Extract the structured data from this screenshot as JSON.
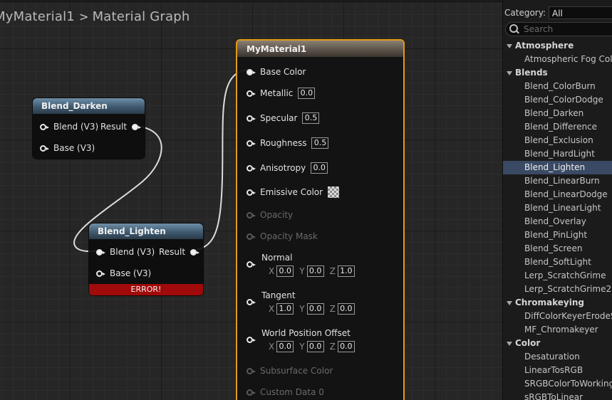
{
  "breadcrumb": {
    "asset": "MyMaterial1",
    "separator": ">",
    "graph": "Material Graph"
  },
  "nodes": {
    "blend_darken": {
      "title": "Blend_Darken",
      "pins": {
        "blend": "Blend (V3)",
        "base": "Base (V3)",
        "result": "Result"
      }
    },
    "blend_lighten": {
      "title": "Blend_Lighten",
      "pins": {
        "blend": "Blend (V3)",
        "base": "Base (V3)",
        "result": "Result"
      },
      "error": "ERROR!"
    }
  },
  "material": {
    "title": "MyMaterial1",
    "inputs": {
      "base_color": "Base Color",
      "metallic": {
        "label": "Metallic",
        "value": "0.0"
      },
      "specular": {
        "label": "Specular",
        "value": "0.5"
      },
      "roughness": {
        "label": "Roughness",
        "value": "0.5"
      },
      "anisotropy": {
        "label": "Anisotropy",
        "value": "0.0"
      },
      "emissive": "Emissive Color",
      "opacity": "Opacity",
      "opacity_mask": "Opacity Mask",
      "normal": {
        "label": "Normal",
        "x": "0.0",
        "y": "0.0",
        "z": "1.0"
      },
      "tangent": {
        "label": "Tangent",
        "x": "1.0",
        "y": "0.0",
        "z": "0.0"
      },
      "wpo": {
        "label": "World Position Offset",
        "x": "0.0",
        "y": "0.0",
        "z": "0.0"
      },
      "subsurface": "Subsurface Color",
      "custom_data": "Custom Data 0"
    },
    "axis_labels": {
      "x": "X",
      "y": "Y",
      "z": "Z"
    }
  },
  "palette": {
    "category_label": "Category:",
    "category_value": "All",
    "search_placeholder": "Search",
    "tree": [
      {
        "type": "category",
        "label": "Atmosphere"
      },
      {
        "type": "item",
        "label": "Atmospheric Fog Color"
      },
      {
        "type": "category",
        "label": "Blends"
      },
      {
        "type": "item",
        "label": "Blend_ColorBurn"
      },
      {
        "type": "item",
        "label": "Blend_ColorDodge"
      },
      {
        "type": "item",
        "label": "Blend_Darken"
      },
      {
        "type": "item",
        "label": "Blend_Difference"
      },
      {
        "type": "item",
        "label": "Blend_Exclusion"
      },
      {
        "type": "item",
        "label": "Blend_HardLight"
      },
      {
        "type": "item",
        "label": "Blend_Lighten",
        "selected": true
      },
      {
        "type": "item",
        "label": "Blend_LinearBurn"
      },
      {
        "type": "item",
        "label": "Blend_LinearDodge"
      },
      {
        "type": "item",
        "label": "Blend_LinearLight"
      },
      {
        "type": "item",
        "label": "Blend_Overlay"
      },
      {
        "type": "item",
        "label": "Blend_PinLight"
      },
      {
        "type": "item",
        "label": "Blend_Screen"
      },
      {
        "type": "item",
        "label": "Blend_SoftLight"
      },
      {
        "type": "item",
        "label": "Lerp_ScratchGrime"
      },
      {
        "type": "item",
        "label": "Lerp_ScratchGrime2"
      },
      {
        "type": "category",
        "label": "Chromakeying"
      },
      {
        "type": "item",
        "label": "DiffColorKeyerErodeSoft"
      },
      {
        "type": "item",
        "label": "MF_Chromakeyer"
      },
      {
        "type": "category",
        "label": "Color"
      },
      {
        "type": "item",
        "label": "Desaturation"
      },
      {
        "type": "item",
        "label": "LinearTosRGB"
      },
      {
        "type": "item",
        "label": "SRGBColorToWorkingColor"
      },
      {
        "type": "item",
        "label": "sRGBToLinear"
      }
    ]
  },
  "colors": {
    "selection_border": "#e39b14",
    "error_bar": "#a10a0a",
    "selected_item": "#3a4a64"
  }
}
